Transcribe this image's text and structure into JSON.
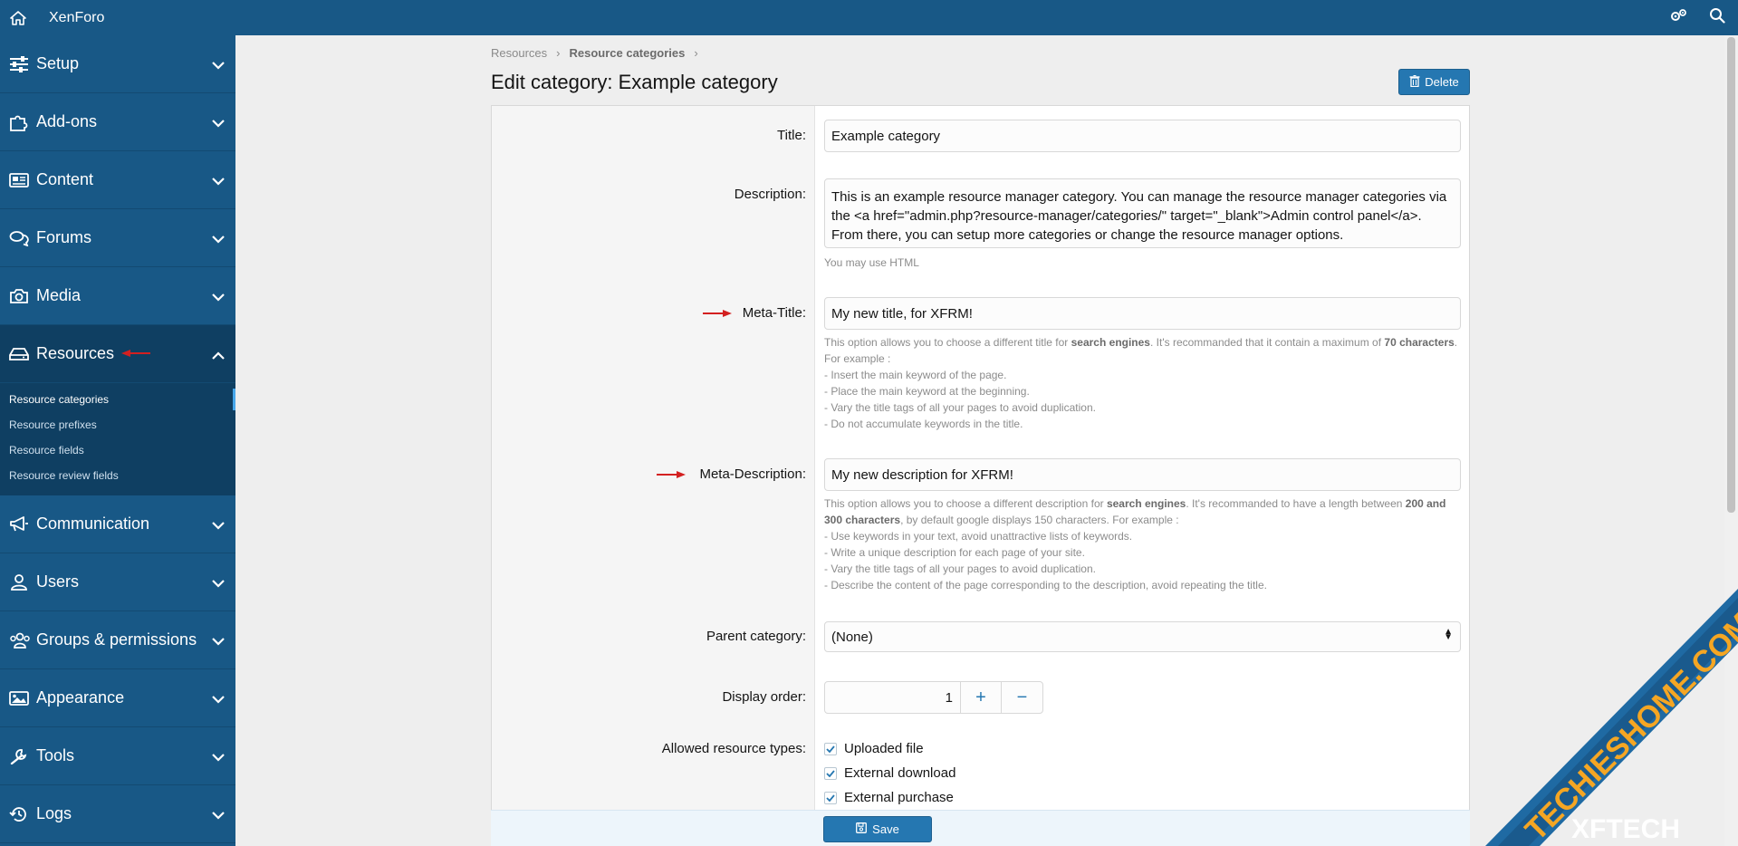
{
  "app": {
    "brand": "XenForo"
  },
  "sidebar": {
    "items": [
      {
        "label": "Setup",
        "icon": "sliders-icon"
      },
      {
        "label": "Add-ons",
        "icon": "puzzle-icon"
      },
      {
        "label": "Content",
        "icon": "newspaper-icon"
      },
      {
        "label": "Forums",
        "icon": "comments-icon"
      },
      {
        "label": "Media",
        "icon": "camera-icon"
      },
      {
        "label": "Resources",
        "icon": "drive-icon"
      },
      {
        "label": "Communication",
        "icon": "megaphone-icon"
      },
      {
        "label": "Users",
        "icon": "user-icon"
      },
      {
        "label": "Groups & permissions",
        "icon": "users-icon"
      },
      {
        "label": "Appearance",
        "icon": "image-icon"
      },
      {
        "label": "Tools",
        "icon": "wrench-icon"
      },
      {
        "label": "Logs",
        "icon": "history-icon"
      }
    ],
    "resources_sub": [
      {
        "label": "Resource categories"
      },
      {
        "label": "Resource prefixes"
      },
      {
        "label": "Resource fields"
      },
      {
        "label": "Resource review fields"
      }
    ]
  },
  "breadcrumb": {
    "items": [
      "Resources",
      "Resource categories"
    ]
  },
  "page": {
    "title": "Edit category: Example category",
    "delete_label": "Delete"
  },
  "form": {
    "title": {
      "label": "Title:",
      "value": "Example category"
    },
    "description": {
      "label": "Description:",
      "lines": [
        "This is an example resource manager category. You can manage the resource manager categories via",
        "the <a href=\"admin.php?resource-manager/categories/\" target=\"_blank\">Admin control panel</a>.",
        "From there, you can setup more categories or change the resource manager options."
      ],
      "hint": "You may use HTML"
    },
    "meta_title": {
      "label": "Meta-Title:",
      "value": "My new title, for XFRM!",
      "hint_parts": [
        "This option allows you to choose a different title for ",
        "search engines",
        ". It's recommanded that it contain a maximum of ",
        "70 characters",
        ". For example :"
      ],
      "hint_lines": [
        "- Insert the main keyword of the page.",
        "- Place the main keyword at the beginning.",
        "- Vary the title tags of all your pages to avoid duplication.",
        "- Do not accumulate keywords in the title."
      ]
    },
    "meta_description": {
      "label": "Meta-Description:",
      "value": "My new description for XFRM!",
      "hint_parts": [
        "This option allows you to choose a different description for ",
        "search engines",
        ". It's recommanded to have a length between ",
        "200 and 300 characters",
        ", by default google displays 150 characters. For example :"
      ],
      "hint_lines": [
        "- Use keywords in your text, avoid unattractive lists of keywords.",
        "- Write a unique description for each page of your site.",
        "- Vary the title tags of all your pages to avoid duplication.",
        "- Describe the content of the page corresponding to the description, avoid repeating the title."
      ]
    },
    "parent_category": {
      "label": "Parent category:",
      "value": "(None)"
    },
    "display_order": {
      "label": "Display order:",
      "value": "1",
      "plus": "+",
      "minus": "−"
    },
    "allowed_types": {
      "label": "Allowed resource types:",
      "options": [
        "Uploaded file",
        "External download",
        "External purchase"
      ]
    },
    "save_label": "Save"
  },
  "watermark": {
    "text1": "TECHIESHOME.COM",
    "text2": "XFTECH"
  },
  "colors": {
    "header": "#185886",
    "accent": "#2577b1",
    "annotation_arrow": "#d32020"
  }
}
